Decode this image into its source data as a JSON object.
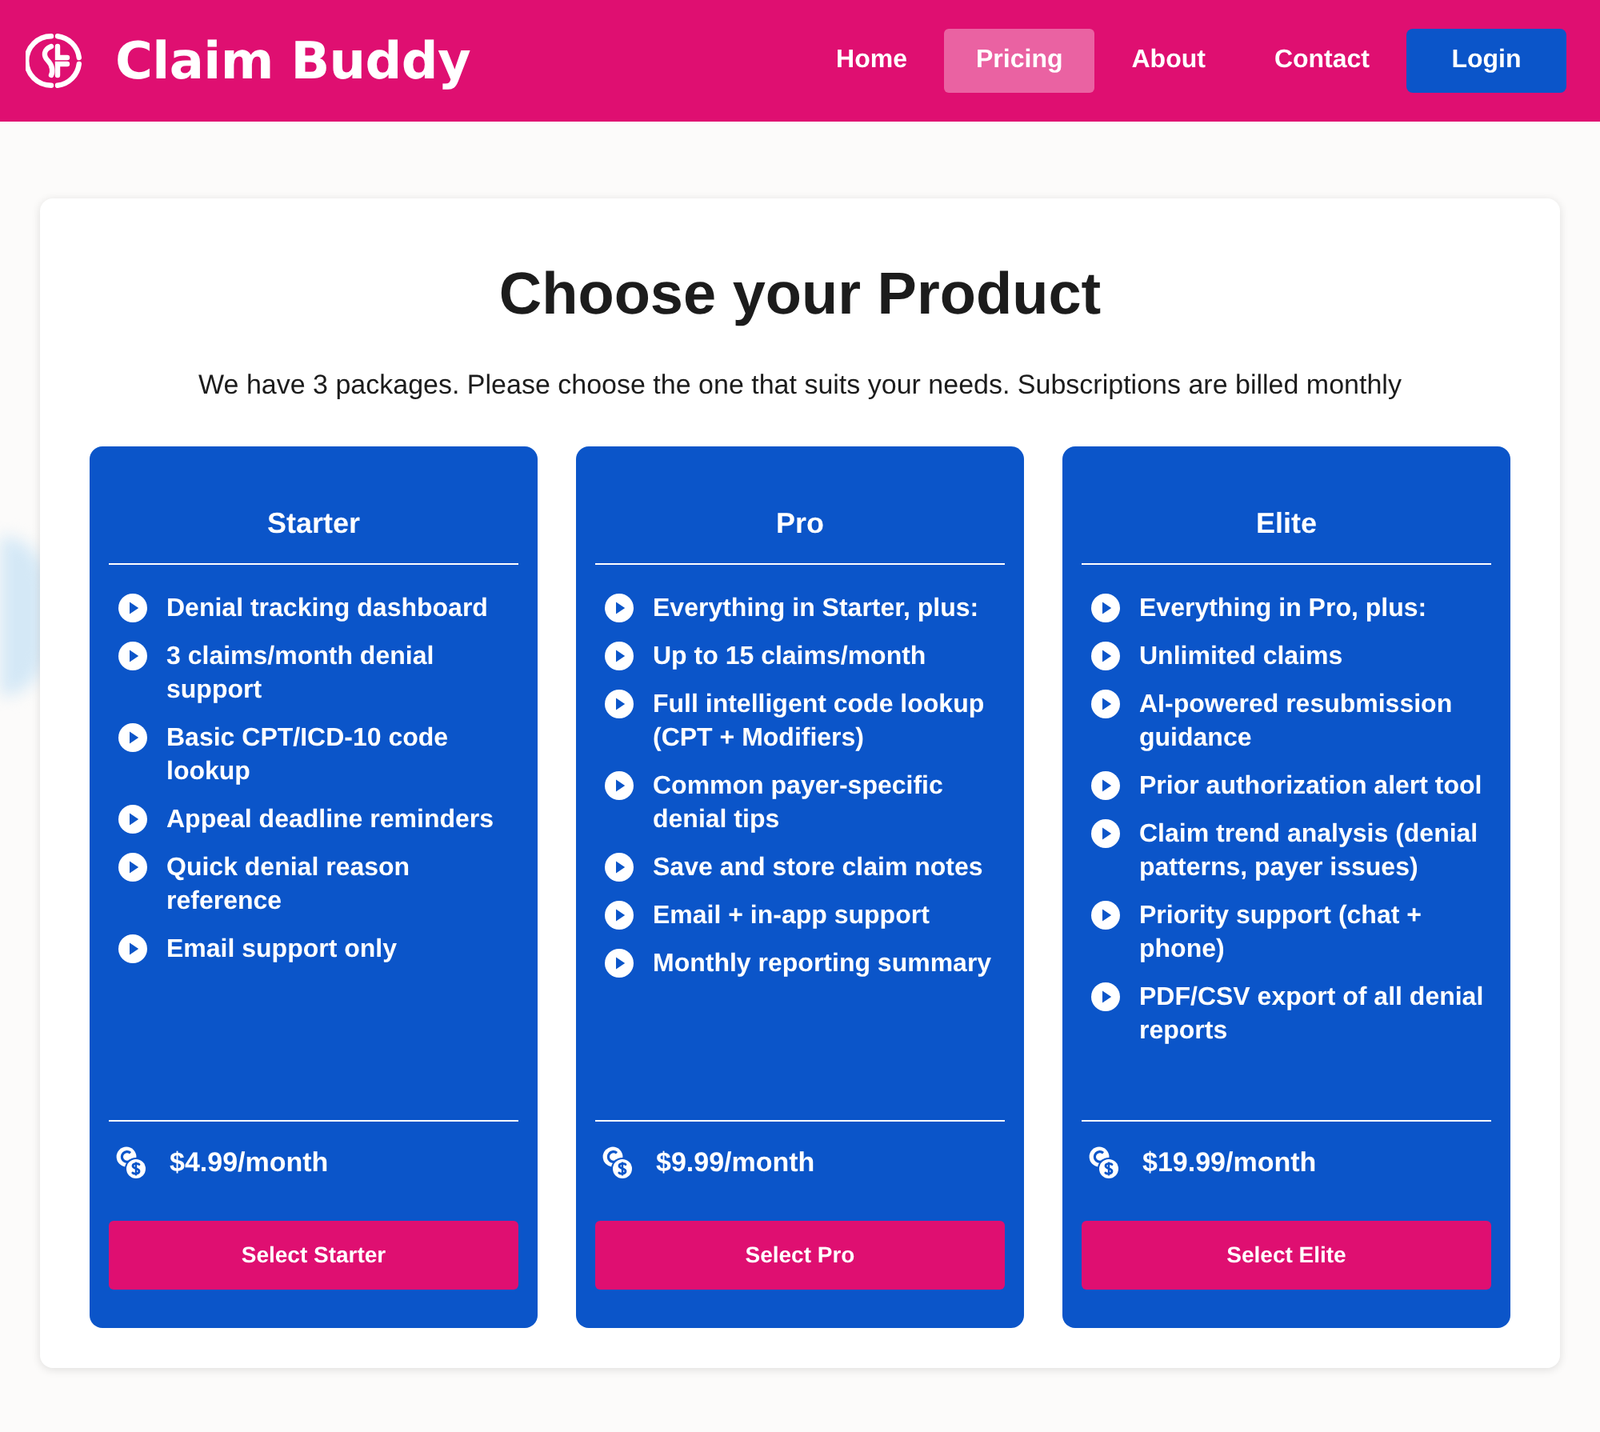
{
  "header": {
    "brand": "Claim Buddy",
    "nav": [
      {
        "label": "Home",
        "selected": false
      },
      {
        "label": "Pricing",
        "selected": true
      },
      {
        "label": "About",
        "selected": false
      },
      {
        "label": "Contact",
        "selected": false
      }
    ],
    "login_button": "Login"
  },
  "pricing": {
    "title": "Choose your Product",
    "subtitle": "We have 3 packages. Please choose the one that suits your needs. Subscriptions are billed monthly",
    "plans": [
      {
        "name": "Starter",
        "features": [
          "Denial tracking dashboard",
          "3 claims/month denial support",
          "Basic CPT/ICD-10 code lookup",
          "Appeal deadline reminders",
          "Quick denial reason reference",
          "Email support only"
        ],
        "price": "$4.99/month",
        "button": "Select Starter"
      },
      {
        "name": "Pro",
        "features": [
          "Everything in Starter, plus:",
          "Up to 15 claims/month",
          "Full intelligent code lookup (CPT + Modifiers)",
          "Common payer-specific denial tips",
          "Save and store claim notes",
          "Email + in-app support",
          "Monthly reporting summary"
        ],
        "price": "$9.99/month",
        "button": "Select Pro"
      },
      {
        "name": "Elite",
        "features": [
          "Everything in Pro, plus:",
          "Unlimited claims",
          "AI-powered resubmission guidance",
          "Prior authorization alert tool",
          "Claim trend analysis (denial patterns, payer issues)",
          "Priority support (chat + phone)",
          "PDF/CSV export of all denial reports"
        ],
        "price": "$19.99/month",
        "button": "Select Elite"
      }
    ]
  }
}
